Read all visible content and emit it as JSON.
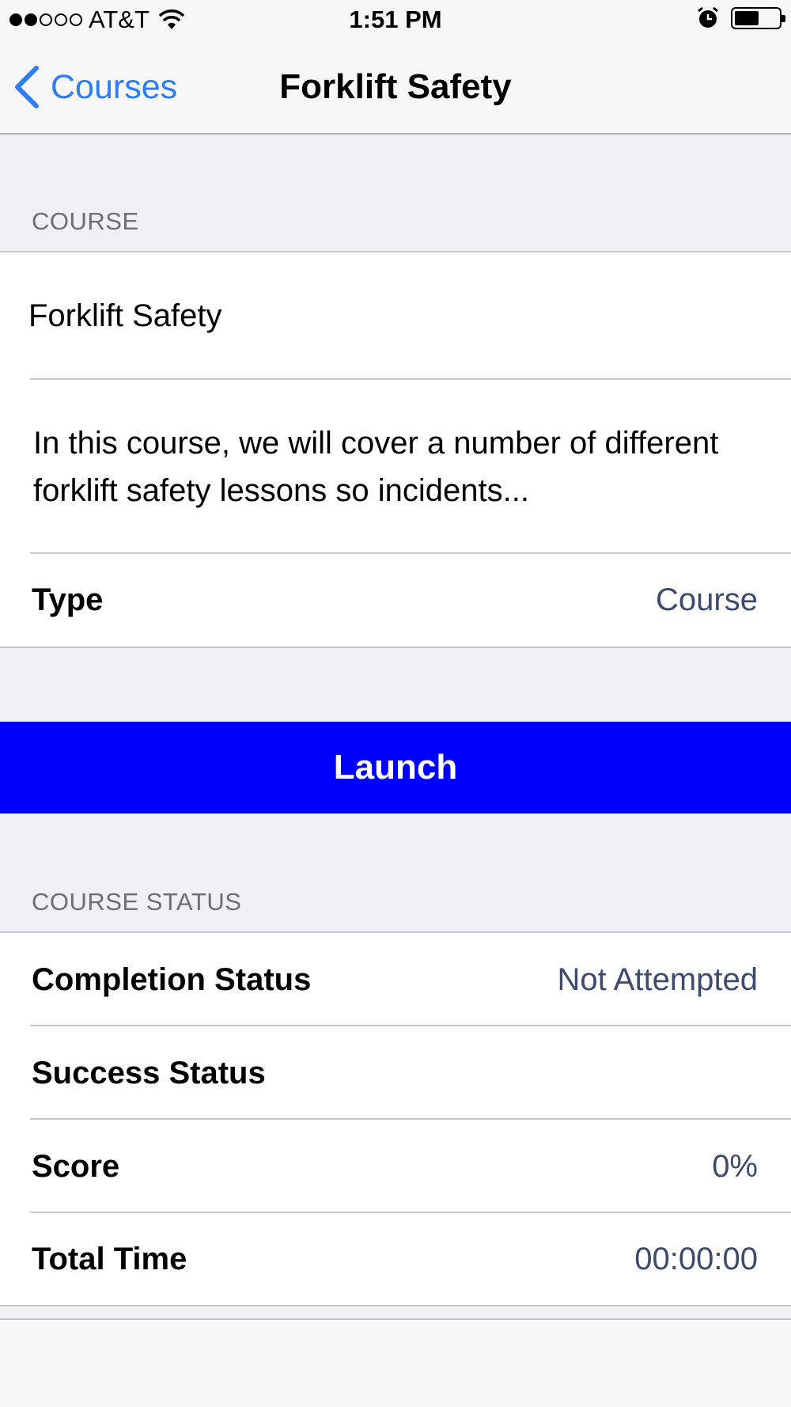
{
  "status_bar": {
    "signal_filled": 2,
    "signal_total": 5,
    "carrier": "AT&T",
    "time": "1:51 PM",
    "battery_level": 0.55
  },
  "nav": {
    "back_label": "Courses",
    "title": "Forklift Safety"
  },
  "course_section": {
    "header": "COURSE",
    "name": "Forklift Safety",
    "description": "In this course, we will cover a number of different forklift safety lessons so incidents...",
    "type_label": "Type",
    "type_value": "Course"
  },
  "launch_label": "Launch",
  "status_section": {
    "header": "COURSE STATUS",
    "rows": [
      {
        "label": "Completion Status",
        "value": "Not Attempted"
      },
      {
        "label": "Success Status",
        "value": ""
      },
      {
        "label": "Score",
        "value": "0%"
      },
      {
        "label": "Total Time",
        "value": "00:00:00"
      }
    ]
  },
  "colors": {
    "accent": "#2e7cf6",
    "launch_bg": "#0000ff",
    "value_text": "#3f4a6b",
    "background": "#efeff4"
  }
}
